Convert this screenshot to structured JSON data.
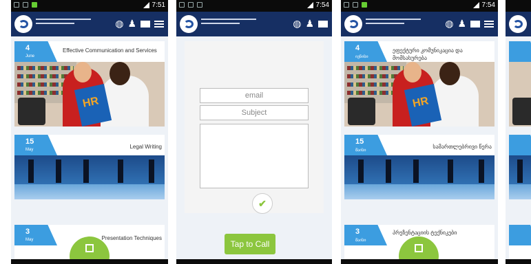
{
  "status": {
    "time_1": "7:51",
    "time_2": "7:54",
    "time_3": "7:54"
  },
  "colors": {
    "appbar": "#162f63",
    "date_badge": "#3c9de0",
    "accent_green": "#8cc63e"
  },
  "screen1": {
    "cards": [
      {
        "day": "4",
        "month": "June",
        "title": "Effective Communication and Services"
      },
      {
        "day": "15",
        "month": "May",
        "title": "Legal Writing"
      },
      {
        "day": "3",
        "month": "May",
        "title": "Presentation Techniques"
      }
    ]
  },
  "screen2": {
    "email_placeholder": "email",
    "subject_placeholder": "Subject",
    "submit_icon": "check-icon",
    "call_button": "Tap to Call"
  },
  "screen3": {
    "cards": [
      {
        "day": "4",
        "month": "ივნისი",
        "title": "ეფექტური კომუნიკაცია და მომსახურება"
      },
      {
        "day": "15",
        "month": "მაისი",
        "title": "სამართლებრივი წერა"
      },
      {
        "day": "3",
        "month": "მაისი",
        "title": "პრეზენტაციის ტექნიკები"
      }
    ]
  }
}
